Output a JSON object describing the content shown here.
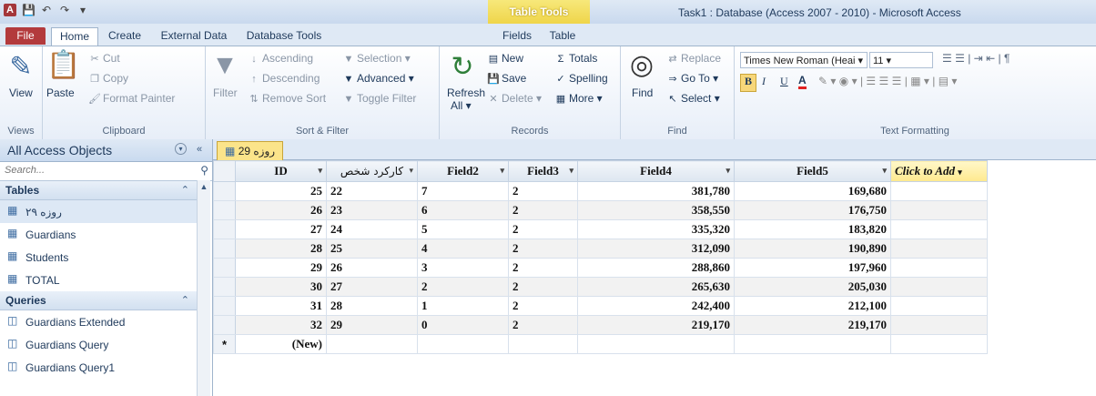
{
  "titlebar": {
    "contextual_tab": "Table Tools",
    "window_title": "Task1 : Database (Access 2007 - 2010)  -  Microsoft Access",
    "qat_icons": [
      "access-icon",
      "save-icon",
      "undo-icon",
      "redo-icon",
      "customize-icon"
    ]
  },
  "ribbon_tabs": {
    "file": "File",
    "home": "Home",
    "create": "Create",
    "external": "External Data",
    "dbtools": "Database Tools",
    "fields": "Fields",
    "table": "Table"
  },
  "ribbon": {
    "views": {
      "view": "View",
      "label": "Views"
    },
    "clipboard": {
      "paste": "Paste",
      "cut": "Cut",
      "copy": "Copy",
      "format_painter": "Format Painter",
      "label": "Clipboard"
    },
    "sortfilter": {
      "filter": "Filter",
      "ascending": "Ascending",
      "descending": "Descending",
      "remove_sort": "Remove Sort",
      "selection": "Selection",
      "advanced": "Advanced",
      "toggle_filter": "Toggle Filter",
      "label": "Sort & Filter"
    },
    "records": {
      "refresh": "Refresh",
      "refresh_all": "All",
      "new": "New",
      "save": "Save",
      "delete": "Delete",
      "totals": "Totals",
      "spelling": "Spelling",
      "more": "More",
      "label": "Records"
    },
    "find": {
      "find": "Find",
      "replace": "Replace",
      "goto": "Go To",
      "select": "Select",
      "label": "Find"
    },
    "textformat": {
      "font_name": "Times New Roman (Heai",
      "font_size": "11",
      "bold": "B",
      "italic": "I",
      "underline": "U",
      "font_color": "A",
      "label": "Text Formatting"
    }
  },
  "nav": {
    "title": "All Access Objects",
    "search_placeholder": "Search...",
    "tables_label": "Tables",
    "tables": [
      "روزه ۲۹",
      "Guardians",
      "Students",
      "TOTAL"
    ],
    "queries_label": "Queries",
    "queries": [
      "Guardians Extended",
      "Guardians Query",
      "Guardians Query1"
    ]
  },
  "document": {
    "tab_label": "روزه 29",
    "columns": [
      "ID",
      "کارکرد شخص",
      "Field2",
      "Field3",
      "Field4",
      "Field5",
      "Click to Add"
    ],
    "rows": [
      [
        "25",
        "22",
        "7",
        "2",
        "381,780",
        "169,680"
      ],
      [
        "26",
        "23",
        "6",
        "2",
        "358,550",
        "176,750"
      ],
      [
        "27",
        "24",
        "5",
        "2",
        "335,320",
        "183,820"
      ],
      [
        "28",
        "25",
        "4",
        "2",
        "312,090",
        "190,890"
      ],
      [
        "29",
        "26",
        "3",
        "2",
        "288,860",
        "197,960"
      ],
      [
        "30",
        "27",
        "2",
        "2",
        "265,630",
        "205,030"
      ],
      [
        "31",
        "28",
        "1",
        "2",
        "242,400",
        "212,100"
      ],
      [
        "32",
        "29",
        "0",
        "2",
        "219,170",
        "219,170"
      ]
    ],
    "new_row_marker": "*",
    "new_row_label": "(New)"
  }
}
